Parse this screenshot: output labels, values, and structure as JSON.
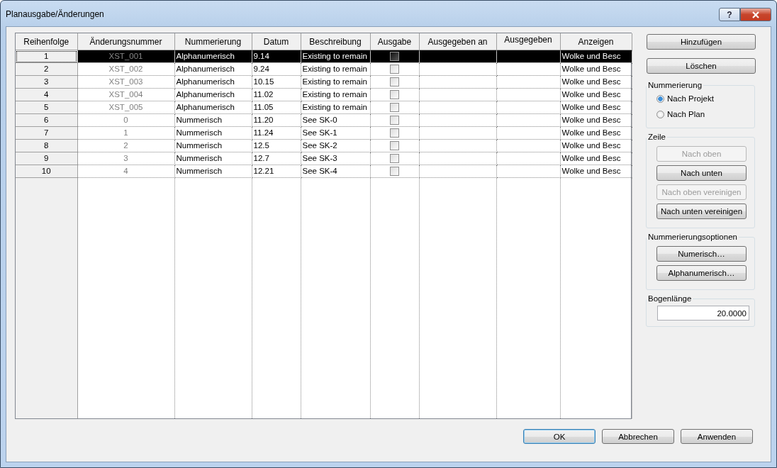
{
  "window": {
    "title": "Planausgabe/Änderungen",
    "help": "?"
  },
  "table": {
    "columns": [
      "Reihenfolge",
      "Änderungsnummer",
      "Nummerierung",
      "Datum",
      "Beschreibung",
      "Ausgabe",
      "Ausgegeben an",
      "Ausgegeben",
      "Anzeigen"
    ],
    "rows": [
      {
        "order": "1",
        "number": "XST_001",
        "numbering": "Alphanumerisch",
        "date": "9.14",
        "description": "Existing to remain",
        "issued": false,
        "show": "Wolke und Besc",
        "selected": true
      },
      {
        "order": "2",
        "number": "XST_002",
        "numbering": "Alphanumerisch",
        "date": "9.24",
        "description": "Existing to remain",
        "issued": false,
        "show": "Wolke und Besc",
        "selected": false
      },
      {
        "order": "3",
        "number": "XST_003",
        "numbering": "Alphanumerisch",
        "date": "10.15",
        "description": "Existing to remain",
        "issued": false,
        "show": "Wolke und Besc",
        "selected": false
      },
      {
        "order": "4",
        "number": "XST_004",
        "numbering": "Alphanumerisch",
        "date": "11.02",
        "description": "Existing to remain",
        "issued": false,
        "show": "Wolke und Besc",
        "selected": false
      },
      {
        "order": "5",
        "number": "XST_005",
        "numbering": "Alphanumerisch",
        "date": "11.05",
        "description": "Existing to remain",
        "issued": false,
        "show": "Wolke und Besc",
        "selected": false
      },
      {
        "order": "6",
        "number": "0",
        "numbering": "Nummerisch",
        "date": "11.20",
        "description": "See SK-0",
        "issued": false,
        "show": "Wolke und Besc",
        "selected": false
      },
      {
        "order": "7",
        "number": "1",
        "numbering": "Nummerisch",
        "date": "11.24",
        "description": "See SK-1",
        "issued": false,
        "show": "Wolke und Besc",
        "selected": false
      },
      {
        "order": "8",
        "number": "2",
        "numbering": "Nummerisch",
        "date": "12.5",
        "description": "See SK-2",
        "issued": false,
        "show": "Wolke und Besc",
        "selected": false
      },
      {
        "order": "9",
        "number": "3",
        "numbering": "Nummerisch",
        "date": "12.7",
        "description": "See SK-3",
        "issued": false,
        "show": "Wolke und Besc",
        "selected": false
      },
      {
        "order": "10",
        "number": "4",
        "numbering": "Nummerisch",
        "date": "12.21",
        "description": "See SK-4",
        "issued": false,
        "show": "Wolke und Besc",
        "selected": false
      }
    ]
  },
  "actions": [
    {
      "label": "Hinzufügen"
    },
    {
      "label": "Löschen"
    }
  ],
  "numbering": {
    "title": "Nummerierung",
    "options": [
      {
        "label": "Nach Projekt",
        "selected": true
      },
      {
        "label": "Nach Plan",
        "selected": false
      }
    ]
  },
  "row_group": {
    "title": "Zeile",
    "buttons": [
      {
        "label": "Nach oben",
        "disabled": true
      },
      {
        "label": "Nach unten",
        "disabled": false
      },
      {
        "label": "Nach oben vereinigen",
        "disabled": true
      },
      {
        "label": "Nach unten vereinigen",
        "disabled": false
      }
    ]
  },
  "numbering_options": {
    "title": "Nummerierungsoptionen",
    "buttons": [
      {
        "label": "Numerisch…"
      },
      {
        "label": "Alphanumerisch…"
      }
    ]
  },
  "arc_length": {
    "title": "Bogenlänge",
    "value": "20.0000"
  },
  "footer": {
    "buttons": [
      {
        "label": "OK",
        "default": true
      },
      {
        "label": "Abbrechen",
        "default": false
      },
      {
        "label": "Anwenden",
        "default": false
      }
    ]
  }
}
